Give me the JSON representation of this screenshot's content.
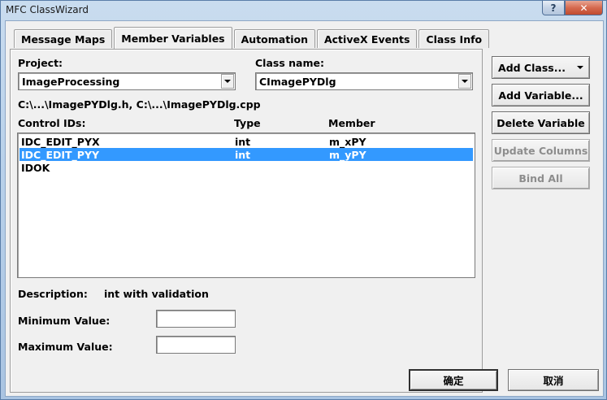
{
  "window": {
    "title": "MFC ClassWizard",
    "help_label": "?",
    "close_label": "✕"
  },
  "tabs": [
    {
      "label": "Message Maps"
    },
    {
      "label": "Member Variables"
    },
    {
      "label": "Automation"
    },
    {
      "label": "ActiveX Events"
    },
    {
      "label": "Class Info"
    }
  ],
  "project": {
    "label": "Project:",
    "value": "ImageProcessing"
  },
  "class_name": {
    "label": "Class name:",
    "value": "CImagePYDlg"
  },
  "files_path": "C:\\...\\ImagePYDlg.h, C:\\...\\ImagePYDlg.cpp",
  "list": {
    "headers": {
      "id": "Control IDs:",
      "type": "Type",
      "member": "Member"
    },
    "rows": [
      {
        "id": "IDC_EDIT_PYX",
        "type": "int",
        "member": "m_xPY"
      },
      {
        "id": "IDC_EDIT_PYY",
        "type": "int",
        "member": "m_yPY"
      },
      {
        "id": "IDOK",
        "type": "",
        "member": ""
      }
    ]
  },
  "description": {
    "label": "Description:",
    "value": "int with validation"
  },
  "minimum": {
    "label": "Minimum Value:",
    "value": ""
  },
  "maximum": {
    "label": "Maximum Value:",
    "value": ""
  },
  "side_buttons": {
    "add_class": "Add Class...",
    "add_variable": "Add Variable...",
    "delete_variable": "Delete Variable",
    "update_columns": "Update Columns",
    "bind_all": "Bind All"
  },
  "footer": {
    "ok": "确定",
    "cancel": "取消"
  }
}
